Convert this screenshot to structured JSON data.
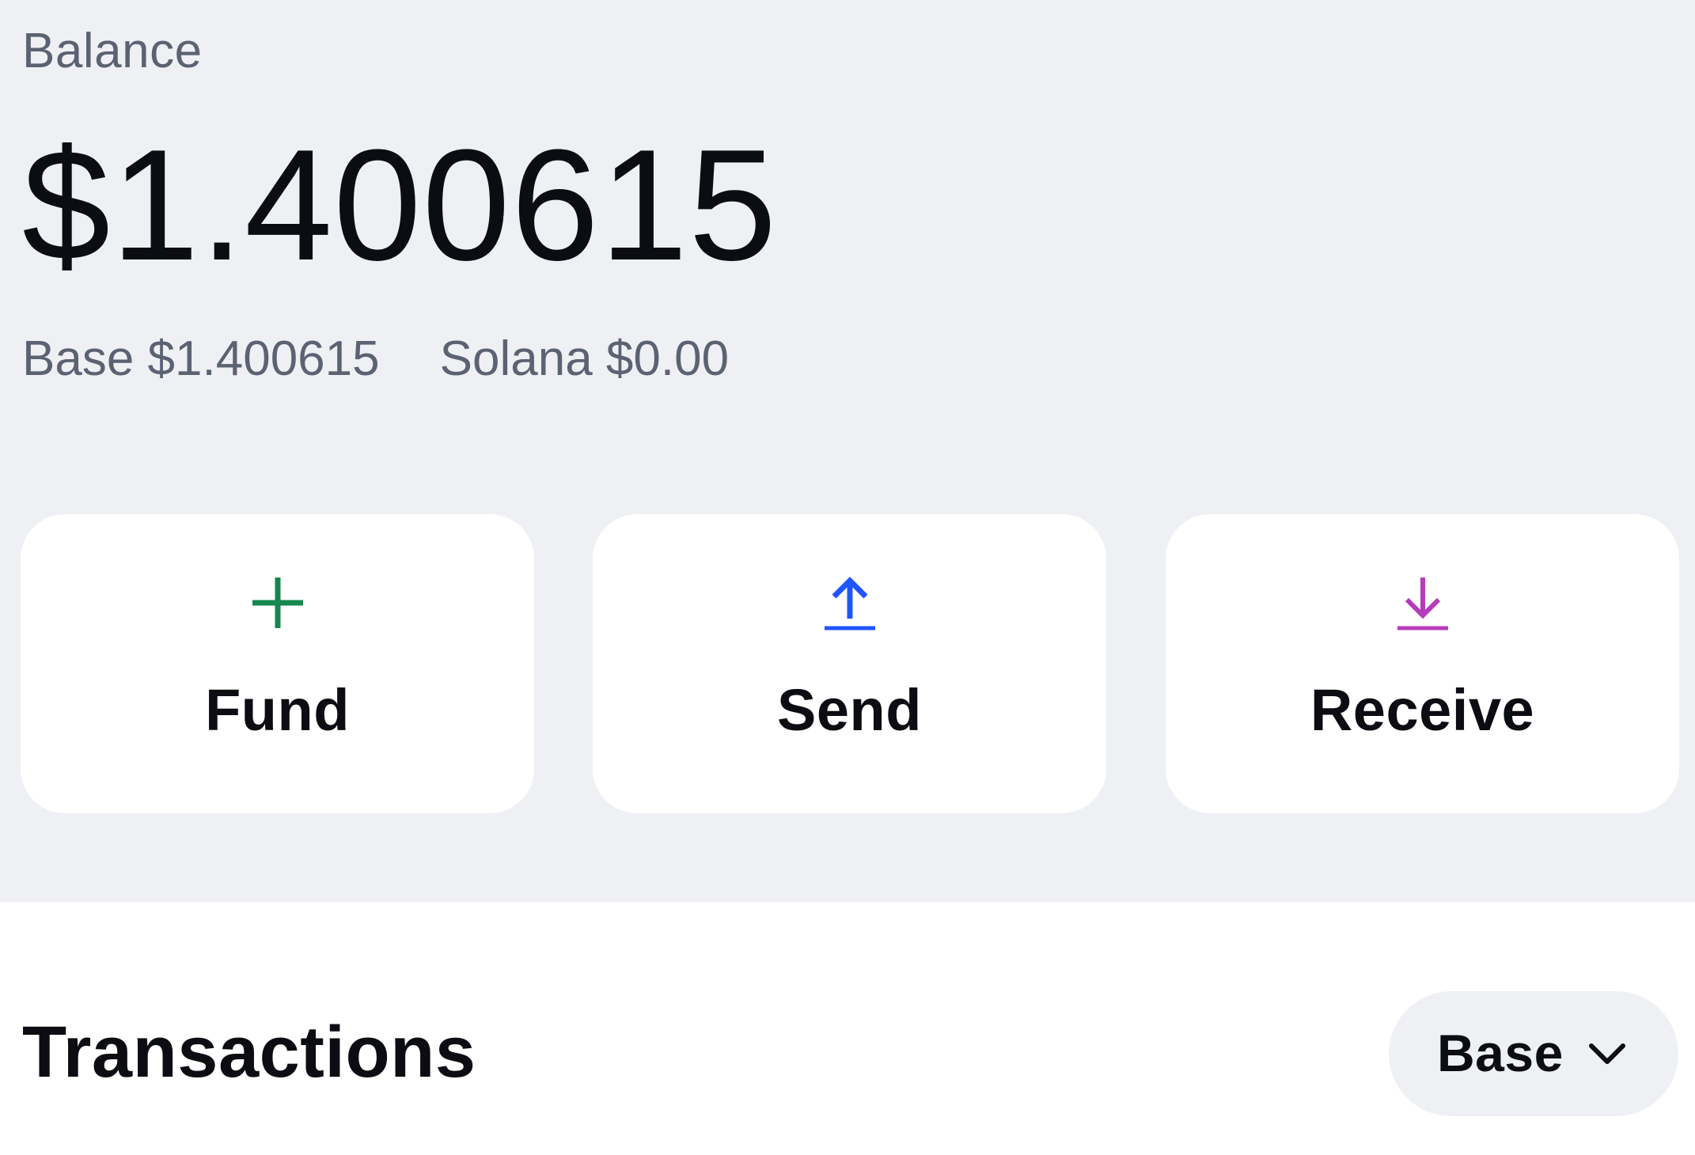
{
  "balance": {
    "label": "Balance",
    "amount": "$1.400615"
  },
  "networks": {
    "base": "Base $1.400615",
    "solana": "Solana $0.00"
  },
  "actions": [
    {
      "label": "Fund",
      "icon": "plus-icon",
      "color": "#15874f"
    },
    {
      "label": "Send",
      "icon": "arrow-up-icon",
      "color": "#1f55ff"
    },
    {
      "label": "Receive",
      "icon": "arrow-down-icon",
      "color": "#b53cba"
    }
  ],
  "transactions": {
    "title": "Transactions",
    "network_selected": "Base",
    "dropdown_icon": "chevron-down-icon"
  },
  "colors": {
    "panel_bg": "#eff0f4",
    "text_primary": "#0b0d12",
    "text_secondary": "#5b6272"
  }
}
